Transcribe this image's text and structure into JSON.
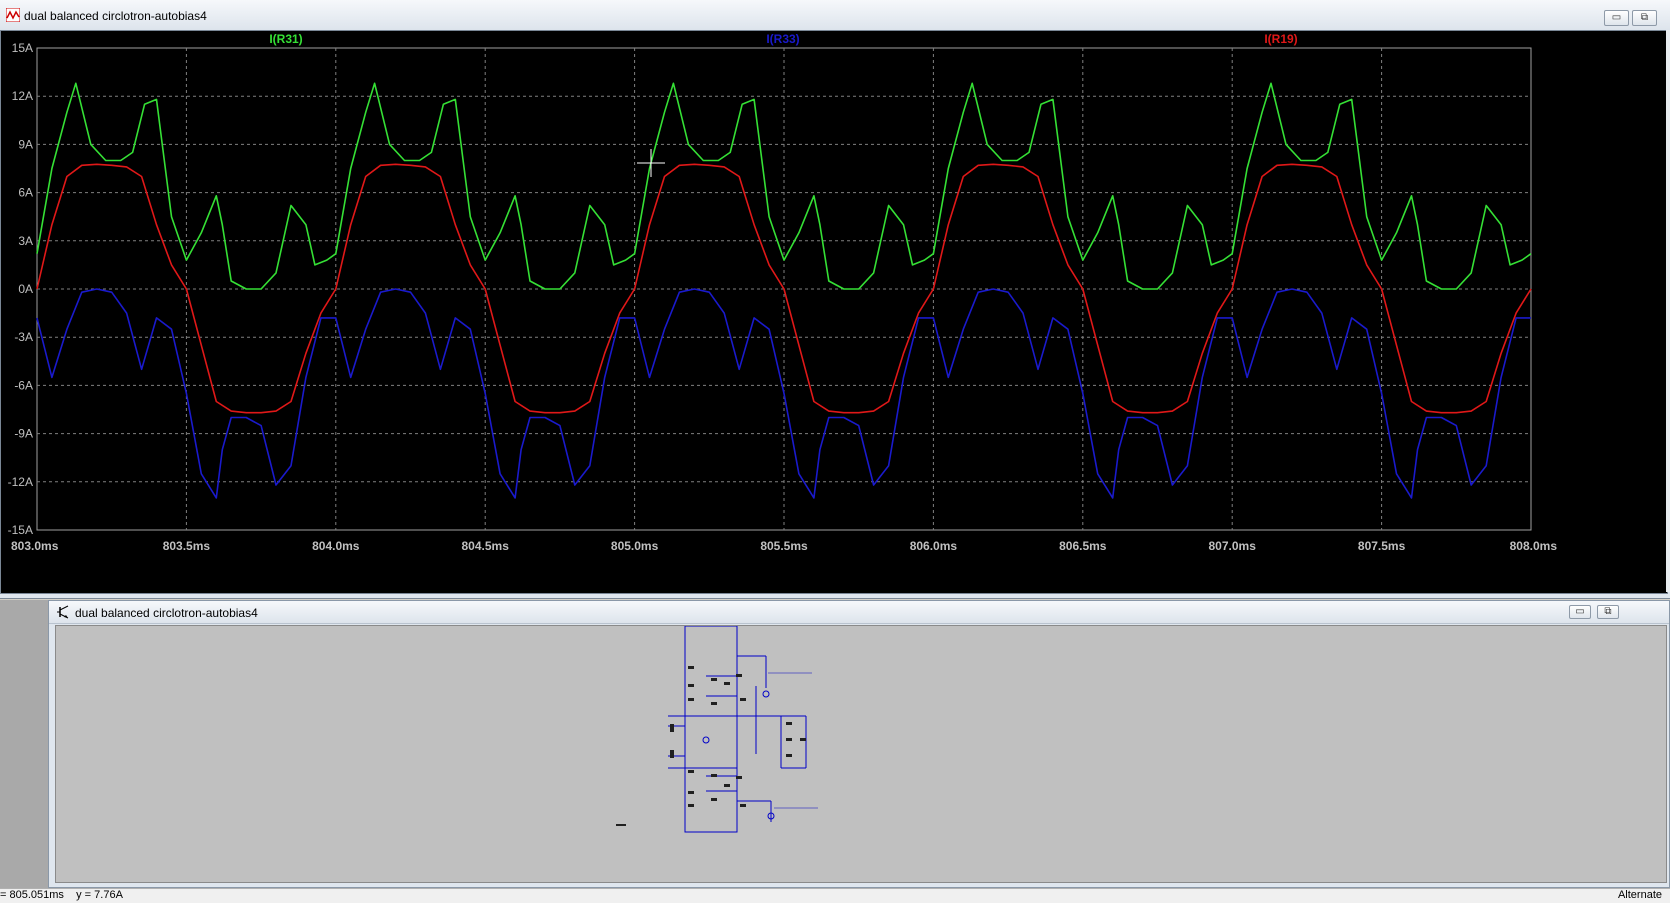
{
  "waveform_window": {
    "title": "dual balanced circlotron-autobias4",
    "controls": {
      "minimize": "▭",
      "restore": "⧉",
      "close": "✕"
    }
  },
  "schematic_window": {
    "title": "dual balanced circlotron-autobias4",
    "controls": {
      "minimize": "▭",
      "restore": "⧉"
    }
  },
  "status_bar": {
    "cursor": "= 805.051ms    y = 7.76A",
    "mode": "Alternate"
  },
  "colors": {
    "background": "#000000",
    "grid": "#808080",
    "axis_text": "#c0c0c0",
    "I_R31": "#35e035",
    "I_R33": "#1a1acc",
    "I_R19": "#e01818",
    "wire": "#0000c8"
  },
  "icons": {
    "waveform_window": "waveform-icon",
    "schematic_window": "transistor-icon"
  },
  "chart_data": {
    "type": "line",
    "xlabel": "",
    "ylabel": "",
    "xlim": [
      803.0,
      808.0
    ],
    "ylim": [
      -15,
      15
    ],
    "x_ticks": [
      "803.0ms",
      "803.5ms",
      "804.0ms",
      "804.5ms",
      "805.0ms",
      "805.5ms",
      "806.0ms",
      "806.5ms",
      "807.0ms",
      "807.5ms",
      "808.0ms"
    ],
    "y_ticks": [
      "15A",
      "12A",
      "9A",
      "6A",
      "3A",
      "0A",
      "-3A",
      "-6A",
      "-9A",
      "-12A",
      "-15A"
    ],
    "grid": true,
    "legend": "top",
    "series": [
      {
        "name": "I(R31)",
        "color": "#35e035",
        "x": [
          803.0,
          803.05,
          803.1,
          803.13,
          803.18,
          803.23,
          803.28,
          803.32,
          803.36,
          803.4,
          803.45,
          803.5,
          803.55,
          803.6,
          803.62,
          803.65,
          803.7,
          803.75,
          803.8,
          803.85,
          803.9,
          803.93,
          803.97,
          804.0
        ],
        "y": [
          2.2,
          7.5,
          11.0,
          12.8,
          9.0,
          8.0,
          8.0,
          8.5,
          11.5,
          11.8,
          4.5,
          1.8,
          3.5,
          5.8,
          4.0,
          0.5,
          0.0,
          0.0,
          1.0,
          5.2,
          4.0,
          1.5,
          1.8,
          2.2
        ]
      },
      {
        "name": "I(R33)",
        "color": "#1a1acc",
        "x": [
          803.0,
          803.05,
          803.1,
          803.15,
          803.2,
          803.25,
          803.3,
          803.35,
          803.4,
          803.45,
          803.5,
          803.55,
          803.6,
          803.62,
          803.65,
          803.7,
          803.75,
          803.8,
          803.85,
          803.9,
          803.95,
          804.0
        ],
        "y": [
          -1.8,
          -5.5,
          -2.5,
          -0.2,
          0.0,
          -0.2,
          -1.5,
          -5.0,
          -1.8,
          -2.5,
          -6.5,
          -11.5,
          -13.0,
          -10.0,
          -8.0,
          -8.0,
          -8.5,
          -12.2,
          -11.0,
          -5.5,
          -1.8,
          -1.8
        ]
      },
      {
        "name": "I(R19)",
        "color": "#e01818",
        "x": [
          803.0,
          803.05,
          803.1,
          803.15,
          803.2,
          803.25,
          803.3,
          803.35,
          803.4,
          803.45,
          803.5,
          803.55,
          803.6,
          803.65,
          803.7,
          803.75,
          803.8,
          803.85,
          803.9,
          803.95,
          804.0
        ],
        "y": [
          0.0,
          4.0,
          7.0,
          7.7,
          7.76,
          7.7,
          7.6,
          7.0,
          4.0,
          1.5,
          0.0,
          -3.5,
          -7.0,
          -7.6,
          -7.7,
          -7.7,
          -7.6,
          -7.0,
          -4.0,
          -1.5,
          0.0
        ]
      }
    ],
    "period_ms": 1.0
  }
}
